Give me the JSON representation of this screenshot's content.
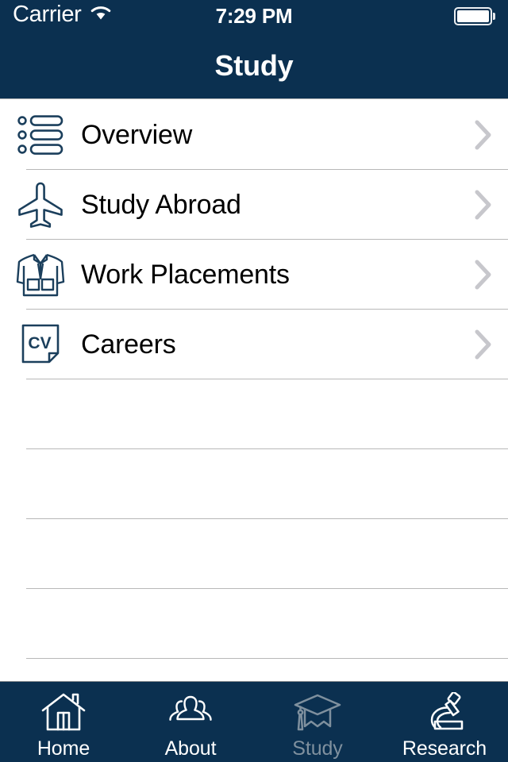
{
  "theme": {
    "navy": "#0b3050",
    "icon_stroke": "#1b3f5c",
    "separator": "#b8b8b8",
    "chevron": "#c7c7cc",
    "tab_active": "#7f909e",
    "tab_inactive": "#ffffff"
  },
  "status_bar": {
    "carrier": "Carrier",
    "wifi_icon": "wifi-icon",
    "time": "7:29 PM",
    "battery_icon": "battery-full-icon",
    "battery_level": 100
  },
  "header": {
    "title": "Study"
  },
  "list": {
    "items": [
      {
        "label": "Overview",
        "icon": "bulleted-list-icon",
        "accessory": "chevron-right-icon"
      },
      {
        "label": "Study Abroad",
        "icon": "airplane-icon",
        "accessory": "chevron-right-icon"
      },
      {
        "label": "Work Placements",
        "icon": "lab-coat-icon",
        "accessory": "chevron-right-icon"
      },
      {
        "label": "Careers",
        "icon": "cv-document-icon",
        "accessory": "chevron-right-icon"
      }
    ],
    "empty_rows": 4
  },
  "tab_bar": {
    "tabs": [
      {
        "label": "Home",
        "icon": "house-icon",
        "active": false
      },
      {
        "label": "About",
        "icon": "people-group-icon",
        "active": false
      },
      {
        "label": "Study",
        "icon": "graduation-cap-icon",
        "active": true
      },
      {
        "label": "Research",
        "icon": "microscope-icon",
        "active": false
      }
    ]
  }
}
